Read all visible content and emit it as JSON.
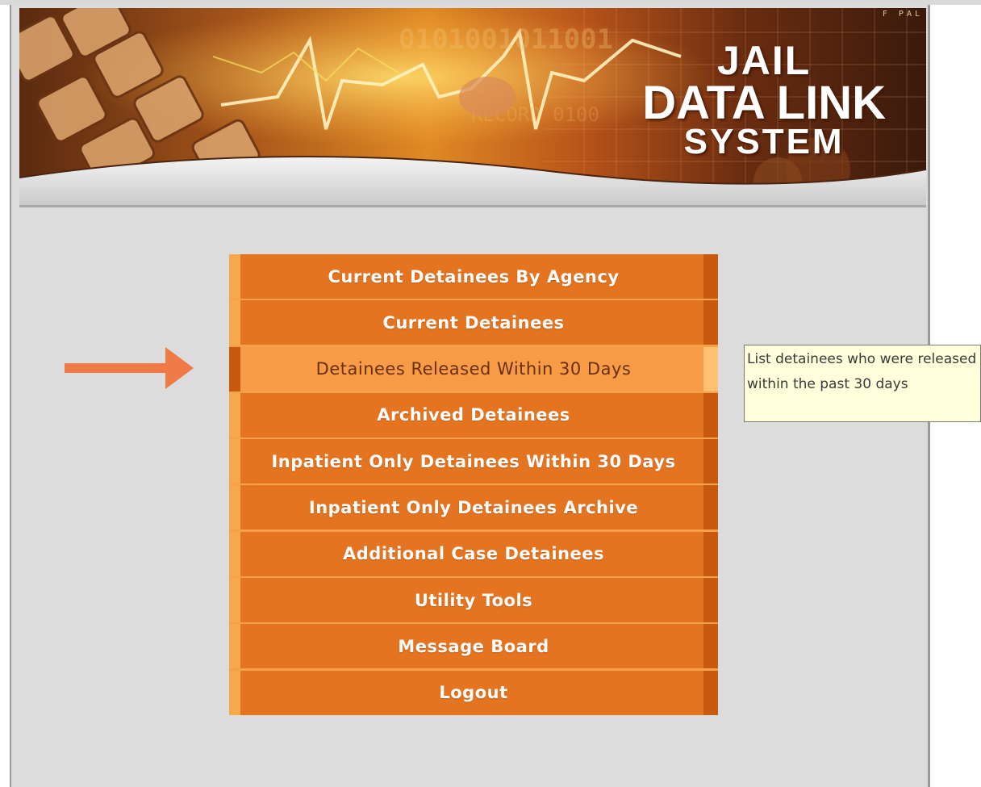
{
  "header": {
    "title_line1": "JAIL",
    "title_line2": "DATA LINK",
    "title_line3": "SYSTEM",
    "corner_text": "F  PAL"
  },
  "menu": {
    "items": [
      {
        "label": "Current Detainees By Agency"
      },
      {
        "label": "Current Detainees"
      },
      {
        "label": "Detainees Released Within 30 Days"
      },
      {
        "label": "Archived Detainees"
      },
      {
        "label": "Inpatient Only Detainees Within 30 Days"
      },
      {
        "label": "Inpatient Only Detainees Archive"
      },
      {
        "label": "Additional Case Detainees"
      },
      {
        "label": "Utility Tools"
      },
      {
        "label": "Message Board"
      },
      {
        "label": "Logout"
      }
    ],
    "active_index": 2
  },
  "tooltip": {
    "text": "List detainees who were released within the past 30 days"
  },
  "colors": {
    "menu_orange": "#e4741f",
    "menu_active": "#f79b47",
    "arrow": "#f07a45",
    "tooltip_bg": "#ffffdc",
    "page_bg": "#dcdcdc"
  },
  "icons": {
    "pointer_arrow": "arrow-right-icon"
  }
}
